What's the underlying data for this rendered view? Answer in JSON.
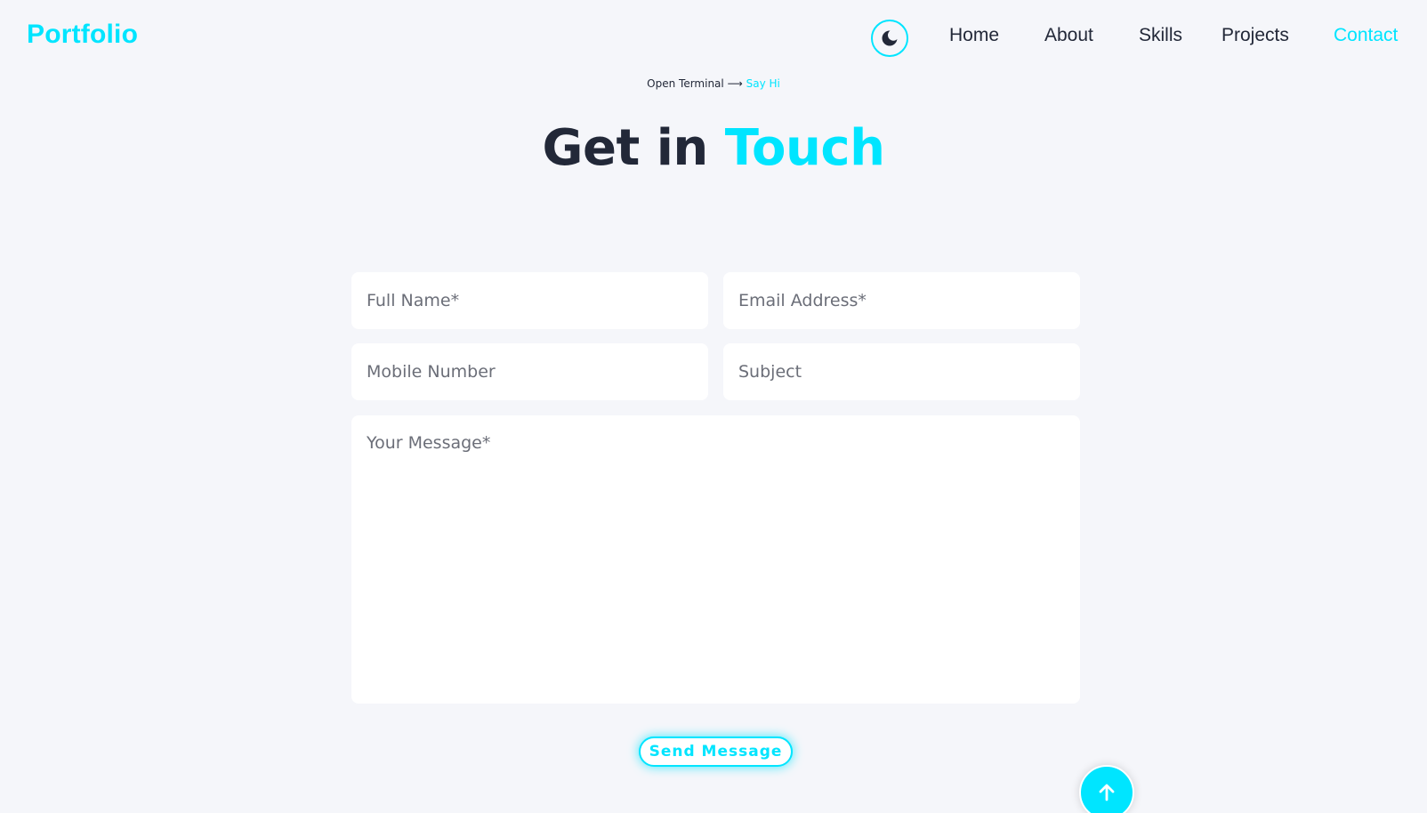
{
  "brand": {
    "logo": "Portfolio"
  },
  "theme_toggle": {
    "icon": "moon-icon"
  },
  "nav": {
    "home": "Home",
    "about": "About",
    "skills": "Skills",
    "projects": "Projects",
    "contact": "Contact",
    "active": "Contact"
  },
  "hint": {
    "prefix": "Open Terminal",
    "arrow": "⟶",
    "link": "Say Hi"
  },
  "title": {
    "part1": "Get in",
    "part2": "Touch"
  },
  "form": {
    "full_name_placeholder": "Full Name*",
    "email_placeholder": "Email Address*",
    "mobile_placeholder": "Mobile Number",
    "subject_placeholder": "Subject",
    "message_placeholder": "Your Message*",
    "submit_label": "Send Message"
  },
  "scroll_top": {
    "icon": "arrow-up-icon"
  },
  "colors": {
    "accent": "#00e5ff",
    "text_dark": "#222838",
    "background": "#f5f6fa",
    "field_bg": "#ffffff"
  }
}
